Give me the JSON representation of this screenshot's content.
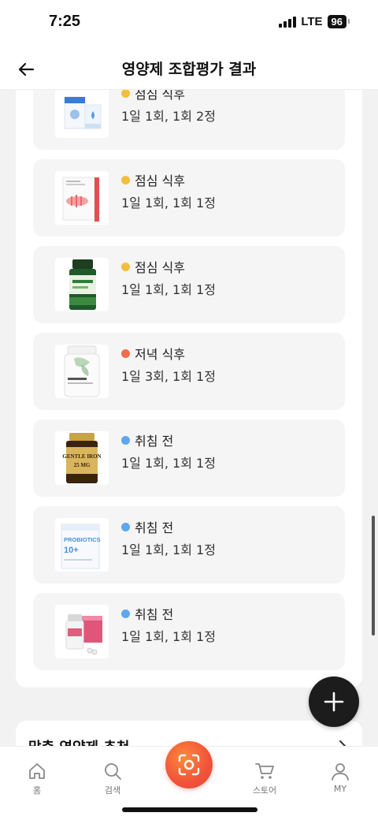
{
  "status_bar": {
    "time": "7:25",
    "network": "LTE",
    "battery": "96"
  },
  "header": {
    "title": "영양제 조합평가 결과"
  },
  "colors": {
    "lunch": "#F4BE3C",
    "dinner": "#F26B4A",
    "bedtime": "#5BA8F0",
    "scan_accent": "#F0523A"
  },
  "items": [
    {
      "timing": "점심 식후",
      "dosage": "1일 1회, 1회 2정",
      "dot": "lunch",
      "product_icon": "supplement-boxes-icon"
    },
    {
      "timing": "점심 식후",
      "dosage": "1일 1회, 1회 1정",
      "dot": "lunch",
      "product_icon": "stick-pack-icon"
    },
    {
      "timing": "점심 식후",
      "dosage": "1일 1회, 1회 1정",
      "dot": "lunch",
      "product_icon": "green-bottle-icon"
    },
    {
      "timing": "저녁 식후",
      "dosage": "1일 3회, 1회 1정",
      "dot": "dinner",
      "product_icon": "white-bottle-icon"
    },
    {
      "timing": "취침 전",
      "dosage": "1일 1회, 1회 1정",
      "dot": "bedtime",
      "product_icon": "gold-bottle-icon"
    },
    {
      "timing": "취침 전",
      "dosage": "1일 1회, 1회 1정",
      "dot": "bedtime",
      "product_icon": "probiotics-box-icon"
    },
    {
      "timing": "취침 전",
      "dosage": "1일 1회, 1회 1정",
      "dot": "bedtime",
      "product_icon": "pink-box-icon"
    }
  ],
  "product_label_text": {
    "gold_bottle_top": "GENTLE IRON",
    "gold_bottle_bottom": "25 MG",
    "probiotics": "PROBIOTICS",
    "probiotics_num": "10+"
  },
  "recommendation": {
    "title": "맞춤 영양제 추천"
  },
  "nav": {
    "home": "홈",
    "search": "검색",
    "store": "스토어",
    "my": "MY"
  }
}
